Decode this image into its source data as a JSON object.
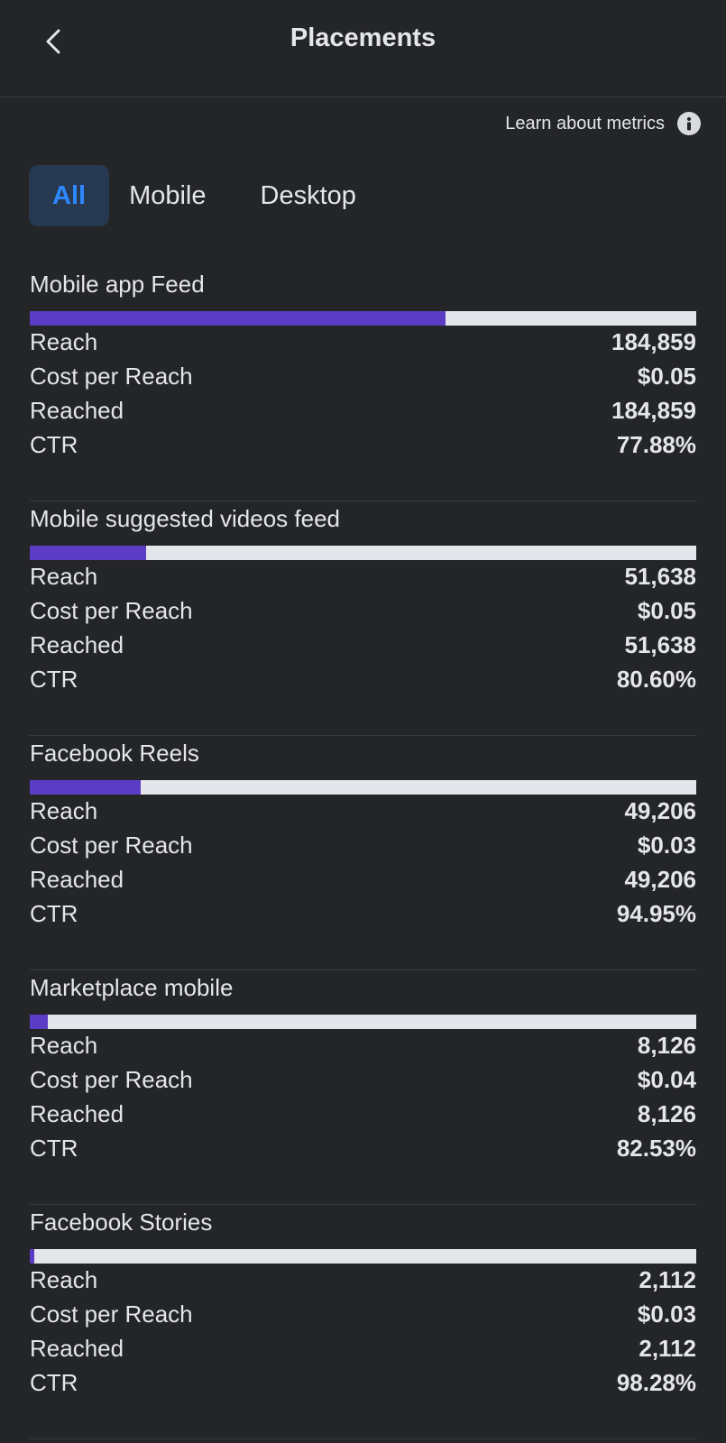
{
  "header": {
    "title": "Placements"
  },
  "learn": {
    "label": "Learn about metrics"
  },
  "tabs": [
    {
      "label": "All",
      "active": true
    },
    {
      "label": "Mobile",
      "active": false
    },
    {
      "label": "Desktop",
      "active": false
    }
  ],
  "accent_color": "#5a3dc4",
  "placements": [
    {
      "name": "Mobile app Feed",
      "bar_fraction": 0.624,
      "metrics": [
        {
          "label": "Reach",
          "value": "184,859"
        },
        {
          "label": "Cost per Reach",
          "value": "$0.05"
        },
        {
          "label": "Reached",
          "value": "184,859"
        },
        {
          "label": "CTR",
          "value": "77.88%"
        }
      ]
    },
    {
      "name": "Mobile suggested videos feed",
      "bar_fraction": 0.174,
      "metrics": [
        {
          "label": "Reach",
          "value": "51,638"
        },
        {
          "label": "Cost per Reach",
          "value": "$0.05"
        },
        {
          "label": "Reached",
          "value": "51,638"
        },
        {
          "label": "CTR",
          "value": "80.60%"
        }
      ]
    },
    {
      "name": "Facebook Reels",
      "bar_fraction": 0.166,
      "metrics": [
        {
          "label": "Reach",
          "value": "49,206"
        },
        {
          "label": "Cost per Reach",
          "value": "$0.03"
        },
        {
          "label": "Reached",
          "value": "49,206"
        },
        {
          "label": "CTR",
          "value": "94.95%"
        }
      ]
    },
    {
      "name": "Marketplace mobile",
      "bar_fraction": 0.027,
      "metrics": [
        {
          "label": "Reach",
          "value": "8,126"
        },
        {
          "label": "Cost per Reach",
          "value": "$0.04"
        },
        {
          "label": "Reached",
          "value": "8,126"
        },
        {
          "label": "CTR",
          "value": "82.53%"
        }
      ]
    },
    {
      "name": "Facebook Stories",
      "bar_fraction": 0.007,
      "metrics": [
        {
          "label": "Reach",
          "value": "2,112"
        },
        {
          "label": "Cost per Reach",
          "value": "$0.03"
        },
        {
          "label": "Reached",
          "value": "2,112"
        },
        {
          "label": "CTR",
          "value": "98.28%"
        }
      ]
    }
  ]
}
